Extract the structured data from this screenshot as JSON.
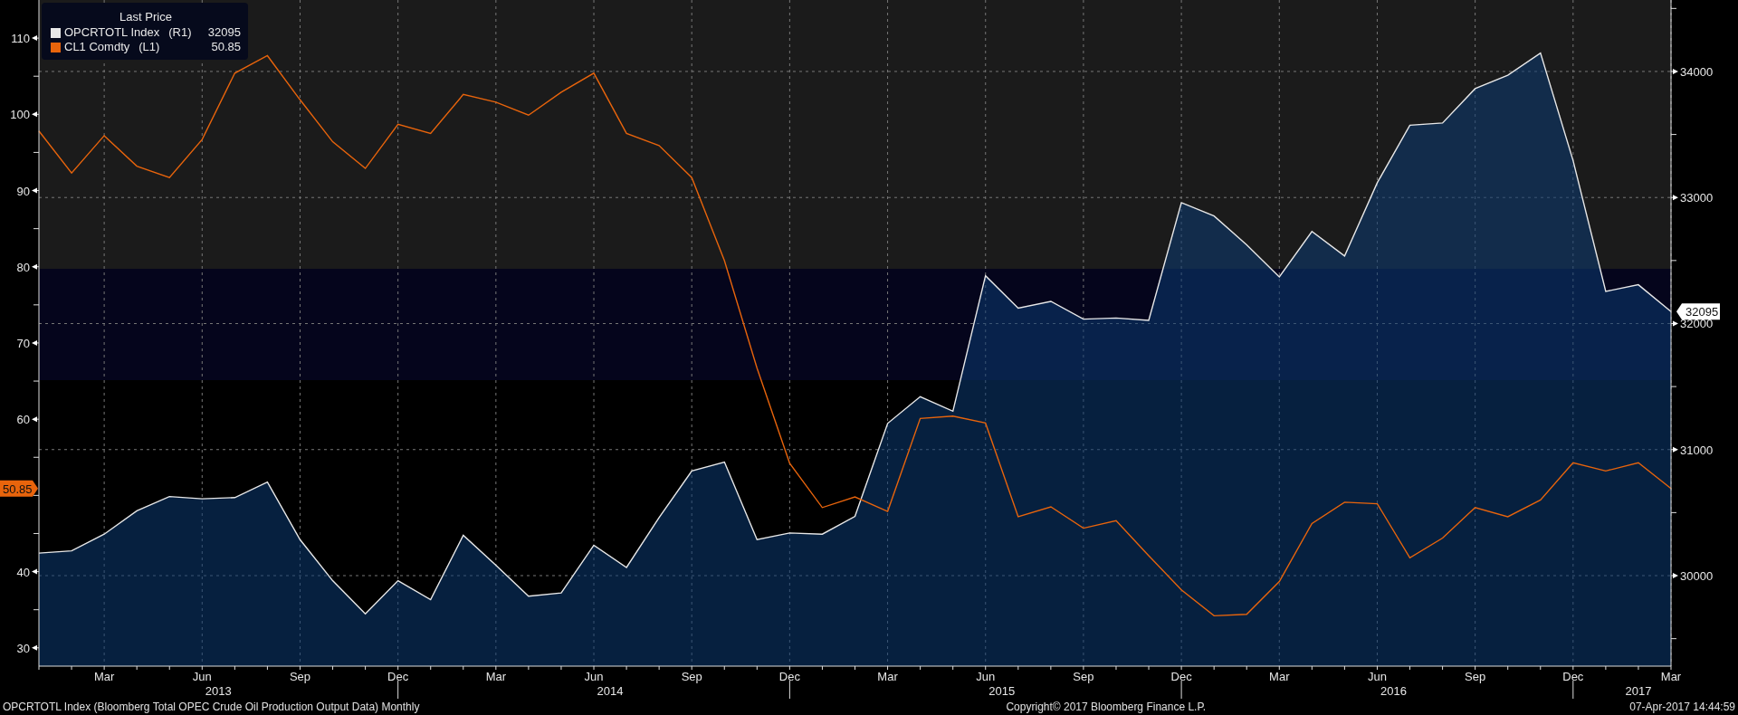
{
  "legend": {
    "title": "Last Price",
    "items": [
      {
        "axis_tag": "(R1)",
        "value": "32095"
      },
      {
        "axis_tag": "(L1)",
        "value": "50.85"
      }
    ]
  },
  "chart": {
    "chart_data": {
      "type": "line",
      "grid": true,
      "legend": "upper left",
      "categories": [
        null,
        null,
        "Mar",
        null,
        null,
        "Jun",
        null,
        null,
        "Sep",
        null,
        null,
        "Dec",
        null,
        null,
        "Mar",
        null,
        null,
        "Jun",
        null,
        null,
        "Sep",
        null,
        null,
        "Dec",
        null,
        null,
        "Mar",
        null,
        null,
        "Jun",
        null,
        null,
        "Sep",
        null,
        null,
        "Dec",
        null,
        null,
        "Mar",
        null,
        null,
        "Jun",
        null,
        null,
        "Sep",
        null,
        null,
        "Dec",
        null,
        null,
        "Mar"
      ],
      "series": [
        {
          "name": "OPCRTOTL Index",
          "color": "#e8e8e8",
          "axis": "y2",
          "type": "area",
          "values": [
            30179,
            30197,
            30329,
            30514,
            30628,
            30610,
            30619,
            30742,
            30285,
            29960,
            29696,
            29960,
            29810,
            30320,
            30083,
            29837,
            29863,
            30241,
            30065,
            30461,
            30830,
            30901,
            30285,
            30338,
            30329,
            30470,
            31208,
            31420,
            31305,
            32379,
            32123,
            32176,
            32035,
            32044,
            32026,
            32959,
            32853,
            32625,
            32370,
            32730,
            32536,
            33117,
            33574,
            33591,
            33864,
            33970,
            34146,
            33293,
            32255,
            32308,
            32095
          ]
        },
        {
          "name": "CL1 Comdty",
          "color": "#e8640c",
          "type": "line",
          "values": [
            97.8,
            92.3,
            97.2,
            93.2,
            91.7,
            96.7,
            105.4,
            107.7,
            101.9,
            96.4,
            92.9,
            98.7,
            97.5,
            102.6,
            101.6,
            99.9,
            102.9,
            105.4,
            97.5,
            95.9,
            91.7,
            80.8,
            66.7,
            54.2,
            48.4,
            49.8,
            47.9,
            60.1,
            60.4,
            59.5,
            47.2,
            48.5,
            45.7,
            46.7,
            42.1,
            37.6,
            34.2,
            34.4,
            38.7,
            46.3,
            49.1,
            48.9,
            41.8,
            44.4,
            48.4,
            47.2,
            49.4,
            54.3,
            53.2,
            54.3,
            50.9
          ]
        }
      ],
      "ylim": [
        27.6,
        115
      ],
      "yticks": [
        30,
        40,
        60,
        70,
        80,
        90,
        100,
        110
      ],
      "y2lim": [
        29282,
        34567
      ],
      "y2ticks": [
        30000,
        31000,
        32000,
        33000,
        34000
      ]
    },
    "year_labels": [
      "2013",
      "2014",
      "2015",
      "2016",
      "2017"
    ],
    "last_value_tags": [
      {
        "label": "32095"
      },
      {
        "label": "50.85"
      }
    ]
  },
  "footer": {
    "description": "OPCRTOTL Index (Bloomberg Total OPEC Crude Oil Production Output Data)  Monthly",
    "copyright": "Copyright© 2017 Bloomberg Finance L.P.",
    "timestamp": "07-Apr-2017 14:44:59"
  }
}
